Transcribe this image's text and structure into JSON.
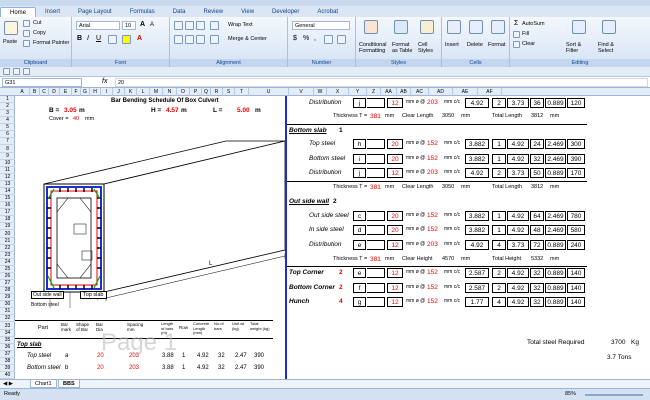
{
  "ribbon_tabs": [
    "Home",
    "Insert",
    "Page Layout",
    "Formulas",
    "Data",
    "Review",
    "View",
    "Developer",
    "Acrobat"
  ],
  "clipboard": {
    "cut": "Cut",
    "copy": "Copy",
    "format_painter": "Format Painter",
    "paste": "Paste",
    "label": "Clipboard"
  },
  "font": {
    "name": "Arial",
    "size": "10",
    "label": "Font"
  },
  "alignment": {
    "wrap": "Wrap Text",
    "merge": "Merge & Center",
    "label": "Alignment"
  },
  "number": {
    "format": "General",
    "label": "Number"
  },
  "styles": {
    "cond": "Conditional Formatting",
    "table": "Format as Table",
    "cell": "Cell Styles",
    "label": "Styles"
  },
  "cells": {
    "insert": "Insert",
    "delete": "Delete",
    "format": "Format",
    "label": "Cells"
  },
  "editing": {
    "autosum": "AutoSum",
    "fill": "Fill",
    "clear": "Clear",
    "sort": "Sort & Filter",
    "find": "Find & Select",
    "label": "Editing"
  },
  "name_box": "G31",
  "formula": "20",
  "col_headers": [
    "A",
    "B",
    "C",
    "D",
    "E",
    "F",
    "G",
    "H",
    "I",
    "J",
    "K",
    "L",
    "M",
    "N",
    "O",
    "P",
    "Q",
    "R",
    "S",
    "T",
    "U",
    "V",
    "W",
    "X",
    "Y",
    "Z",
    "AA",
    "AB",
    "AC",
    "AD",
    "AE",
    "AF"
  ],
  "row_numbers": [
    "1",
    "2",
    "3",
    "4",
    "5",
    "6",
    "7",
    "8",
    "9",
    "10",
    "11",
    "12",
    "13",
    "14",
    "15",
    "16",
    "17",
    "18",
    "19",
    "20",
    "21",
    "22",
    "23",
    "24",
    "25",
    "26",
    "27",
    "28",
    "29",
    "30",
    "31",
    "32",
    "33",
    "34",
    "35",
    "36",
    "37",
    "38",
    "39",
    "40"
  ],
  "left": {
    "title": "Bar Bending Schedule Of Box Culvert",
    "b_label": "B =",
    "b_val": "3.05",
    "h_label": "H =",
    "h_val": "4.57",
    "l_label": "L =",
    "l_val": "5.00",
    "unit": "m",
    "cover_label": "Cover =",
    "cover_val": "40",
    "cover_unit": "mm",
    "out_side_wall": "Out side wall",
    "top_slab": "Top slab",
    "bottom_steel": "Bottom steel",
    "dim_l": "L",
    "table_headers": [
      "Part",
      "Bar mark",
      "Shape of Bar",
      "Bar Dia",
      "Spacing mm",
      "Length of bars (m)",
      "Row",
      "Concrete Length (mm)",
      "No.of bars",
      "Unit wt (kg)",
      "Total weight (kg)"
    ],
    "top_slab_section": "Top slab",
    "rows": [
      {
        "part": "Top steel",
        "mark": "a",
        "dia": "20",
        "spacing": "203",
        "length": "3.88",
        "row": "1",
        "cl": "4.92",
        "nos": "32",
        "wt": "2.47",
        "tw": "390"
      },
      {
        "part": "Bottom steel",
        "mark": "b",
        "dia": "20",
        "spacing": "203",
        "length": "3.88",
        "row": "1",
        "cl": "4.92",
        "nos": "32",
        "wt": "2.47",
        "tw": "390"
      }
    ],
    "watermark": "Page 1"
  },
  "right": {
    "rows": [
      {
        "label": "Distribution",
        "mark": "j",
        "dia": "12",
        "spacing": "203",
        "unit": "mm c/c",
        "v1": "4.92",
        "v2": "2",
        "v3": "3.73",
        "v4": "36",
        "v5": "0.889",
        "v6": "120"
      },
      {
        "label": "Thickness T =",
        "t": "381",
        "tu": "mm",
        "cl": "Clear Length",
        "clv": "3050",
        "clu": "mm",
        "tl": "Total Length",
        "tlv": "3812",
        "tlu": "mm"
      },
      {
        "section": "Bottom slab",
        "num": "1"
      },
      {
        "label": "Top steel",
        "mark": "h",
        "dia": "20",
        "spacing": "152",
        "unit": "mm c/c",
        "v1": "3.882",
        "v2": "1",
        "v3": "4.92",
        "v4": "24",
        "v5": "2.469",
        "v6": "300"
      },
      {
        "label": "Bottom steel",
        "mark": "i",
        "dia": "20",
        "spacing": "152",
        "unit": "mm c/c",
        "v1": "3.882",
        "v2": "1",
        "v3": "4.92",
        "v4": "32",
        "v5": "2.469",
        "v6": "390"
      },
      {
        "label": "Distribution",
        "mark": "j",
        "dia": "12",
        "spacing": "203",
        "unit": "mm c/c",
        "v1": "4.92",
        "v2": "2",
        "v3": "3.73",
        "v4": "50",
        "v5": "0.889",
        "v6": "170"
      },
      {
        "label": "Thickness T =",
        "t": "381",
        "tu": "mm",
        "cl": "Clear Length",
        "clv": "3050",
        "clu": "mm",
        "tl": "Total Length",
        "tlv": "3812",
        "tlu": "mm"
      },
      {
        "section": "Out side wall",
        "num": "2"
      },
      {
        "label": "Out side steel",
        "mark": "c",
        "dia": "20",
        "spacing": "152",
        "unit": "mm c/c",
        "v1": "3.882",
        "v2": "1",
        "v3": "4.92",
        "v4": "64",
        "v5": "2.469",
        "v6": "780"
      },
      {
        "label": "In side steel",
        "mark": "d",
        "dia": "20",
        "spacing": "152",
        "unit": "mm c/c",
        "v1": "3.882",
        "v2": "1",
        "v3": "4.92",
        "v4": "48",
        "v5": "2.469",
        "v6": "580"
      },
      {
        "label": "Distribution",
        "mark": "e",
        "dia": "12",
        "spacing": "203",
        "unit": "mm c/c",
        "v1": "4.92",
        "v2": "4",
        "v3": "3.73",
        "v4": "72",
        "v5": "0.889",
        "v6": "240"
      },
      {
        "label": "Thickness T =",
        "t": "381",
        "tu": "mm",
        "cl": "Clear Height",
        "clv": "4570",
        "clu": "mm",
        "tl": "Total Height",
        "tlv": "5332",
        "tlu": "mm"
      },
      {
        "label": "Top Corner",
        "num": "2",
        "mark": "e",
        "dia": "12",
        "spacing": "152",
        "unit": "mm c/c",
        "v1": "2.587",
        "v2": "2",
        "v3": "4.92",
        "v4": "32",
        "v5": "0.889",
        "v6": "140"
      },
      {
        "label": "Bottom Corner",
        "num": "2",
        "mark": "f",
        "dia": "12",
        "spacing": "152",
        "unit": "mm c/c",
        "v1": "2.587",
        "v2": "2",
        "v3": "4.92",
        "v4": "32",
        "v5": "0.889",
        "v6": "140"
      },
      {
        "label": "Hunch",
        "num": "4",
        "mark": "g",
        "dia": "12",
        "spacing": "152",
        "unit": "mm c/c",
        "v1": "1.77",
        "v2": "4",
        "v3": "4.92",
        "v4": "32",
        "v5": "0.889",
        "v6": "140"
      }
    ],
    "total_label": "Total steel Required",
    "total_kg": "3700",
    "total_kg_unit": "Kg",
    "total_tons": "3.7 Tons"
  },
  "sheets": [
    "Chart1",
    "BBS"
  ],
  "status": {
    "ready": "Ready",
    "zoom": "85%"
  }
}
